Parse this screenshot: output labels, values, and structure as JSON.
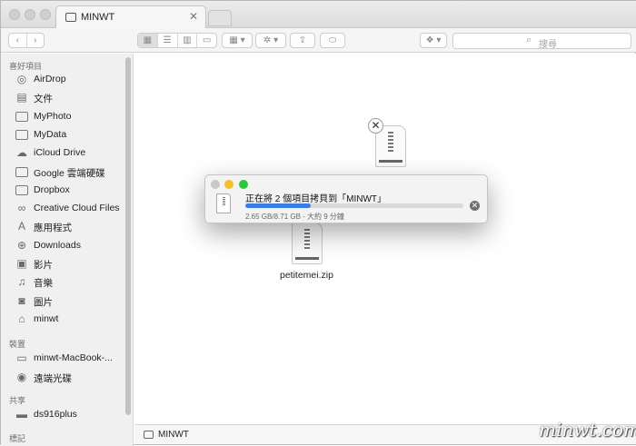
{
  "window": {
    "tab_title": "MINWT",
    "tab_close": "✕"
  },
  "toolbar": {
    "back": "‹",
    "forward": "›",
    "view_icon": "▦",
    "view_list": "☰",
    "view_column": "▥",
    "view_cover": "▭",
    "arrange": "▦ ▾",
    "action": "✲ ▾",
    "share": "⇪",
    "tags": "⬭",
    "dropbox": "❖ ▾",
    "search_icon": "⌕",
    "search_placeholder": "搜尋"
  },
  "sidebar": {
    "favorites_label": "喜好項目",
    "favorites": [
      {
        "label": "AirDrop",
        "icon": "airdrop-icon",
        "glyph": "◎"
      },
      {
        "label": "文件",
        "icon": "documents-icon",
        "glyph": "▤"
      },
      {
        "label": "MyPhoto",
        "icon": "folder-icon",
        "glyph": ""
      },
      {
        "label": "MyData",
        "icon": "folder-icon",
        "glyph": ""
      },
      {
        "label": "iCloud Drive",
        "icon": "cloud-icon",
        "glyph": "☁"
      },
      {
        "label": "Google 雲端硬碟",
        "icon": "folder-icon",
        "glyph": ""
      },
      {
        "label": "Dropbox",
        "icon": "folder-icon",
        "glyph": ""
      },
      {
        "label": "Creative Cloud Files",
        "icon": "creative-cloud-icon",
        "glyph": "∞"
      },
      {
        "label": "應用程式",
        "icon": "applications-icon",
        "glyph": "A"
      },
      {
        "label": "Downloads",
        "icon": "downloads-icon",
        "glyph": "⊕"
      },
      {
        "label": "影片",
        "icon": "movies-icon",
        "glyph": "▣"
      },
      {
        "label": "音樂",
        "icon": "music-icon",
        "glyph": "♫"
      },
      {
        "label": "圖片",
        "icon": "camera-icon",
        "glyph": "◙"
      },
      {
        "label": "minwt",
        "icon": "home-icon",
        "glyph": "⌂"
      }
    ],
    "devices_label": "裝置",
    "devices": [
      {
        "label": "minwt-MacBook-...",
        "icon": "laptop-icon",
        "glyph": "▭"
      },
      {
        "label": "遠端光碟",
        "icon": "disc-icon",
        "glyph": "◉"
      }
    ],
    "shared_label": "共享",
    "shared": [
      {
        "label": "ds916plus",
        "icon": "server-icon",
        "glyph": "▬"
      }
    ],
    "tags_label": "標記"
  },
  "content": {
    "file_name": "petitemei.zip",
    "close_glyph": "✕"
  },
  "copy_dialog": {
    "title": "正在將 2 個項目拷貝到「MINWT」",
    "status": "2.65 GB/8.71 GB - 大約 9 分鐘",
    "progress": 0.3,
    "stop_glyph": "✕",
    "colors": {
      "close": "#c8c8c8",
      "minimize": "#f5bf2f",
      "zoom": "#29c840",
      "progress": "#3a7ee4"
    }
  },
  "pathbar": {
    "label": "MINWT"
  },
  "watermark": "minwt.com"
}
